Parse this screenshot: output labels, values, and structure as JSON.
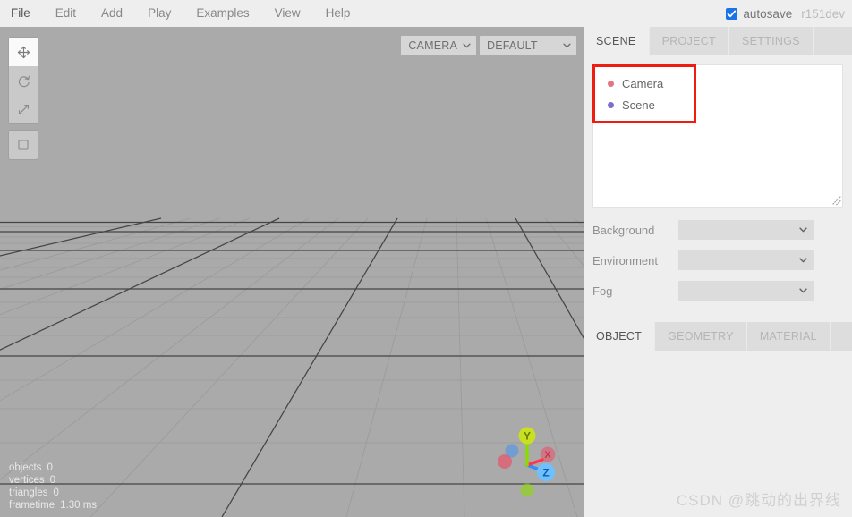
{
  "menubar": {
    "items": [
      {
        "label": "File",
        "name": "menu-file"
      },
      {
        "label": "Edit",
        "name": "menu-edit"
      },
      {
        "label": "Add",
        "name": "menu-add"
      },
      {
        "label": "Play",
        "name": "menu-play"
      },
      {
        "label": "Examples",
        "name": "menu-examples"
      },
      {
        "label": "View",
        "name": "menu-view"
      },
      {
        "label": "Help",
        "name": "menu-help"
      }
    ],
    "autosave_label": "autosave",
    "autosave_checked": true,
    "version": "r151dev"
  },
  "toolbar": {
    "buttons": [
      {
        "icon": "translate-icon",
        "active": true
      },
      {
        "icon": "rotate-icon",
        "active": false
      },
      {
        "icon": "scale-icon",
        "active": false
      }
    ],
    "extra_button": {
      "icon": "square-outline-icon",
      "active": false
    }
  },
  "viewport": {
    "camera_select": "CAMERA",
    "shading_select": "DEFAULT",
    "background_color": "#aaaaaa",
    "stats": [
      {
        "label": "objects",
        "value": "0"
      },
      {
        "label": "vertices",
        "value": "0"
      },
      {
        "label": "triangles",
        "value": "0"
      },
      {
        "label": "frametime",
        "value": "1.30 ms"
      }
    ],
    "axes": {
      "x_label": "X",
      "y_label": "Y",
      "z_label": "Z",
      "x_color": "#ff3653",
      "y_color": "#8adb00",
      "z_color": "#2c8fff"
    }
  },
  "sidebar": {
    "top_tabs": [
      {
        "label": "SCENE",
        "active": true
      },
      {
        "label": "PROJECT",
        "active": false
      },
      {
        "label": "SETTINGS",
        "active": false
      }
    ],
    "outliner": [
      {
        "label": "Camera",
        "dot_color": "#e37580"
      },
      {
        "label": "Scene",
        "dot_color": "#7a6fcf"
      }
    ],
    "properties": [
      {
        "label": "Background",
        "value": ""
      },
      {
        "label": "Environment",
        "value": ""
      },
      {
        "label": "Fog",
        "value": ""
      }
    ],
    "bottom_tabs": [
      {
        "label": "OBJECT",
        "active": true
      },
      {
        "label": "GEOMETRY",
        "active": false
      },
      {
        "label": "MATERIAL",
        "active": false
      }
    ]
  },
  "annotation": {
    "highlight_color": "#ee1c11"
  },
  "watermark": "CSDN @跳动的出界线"
}
